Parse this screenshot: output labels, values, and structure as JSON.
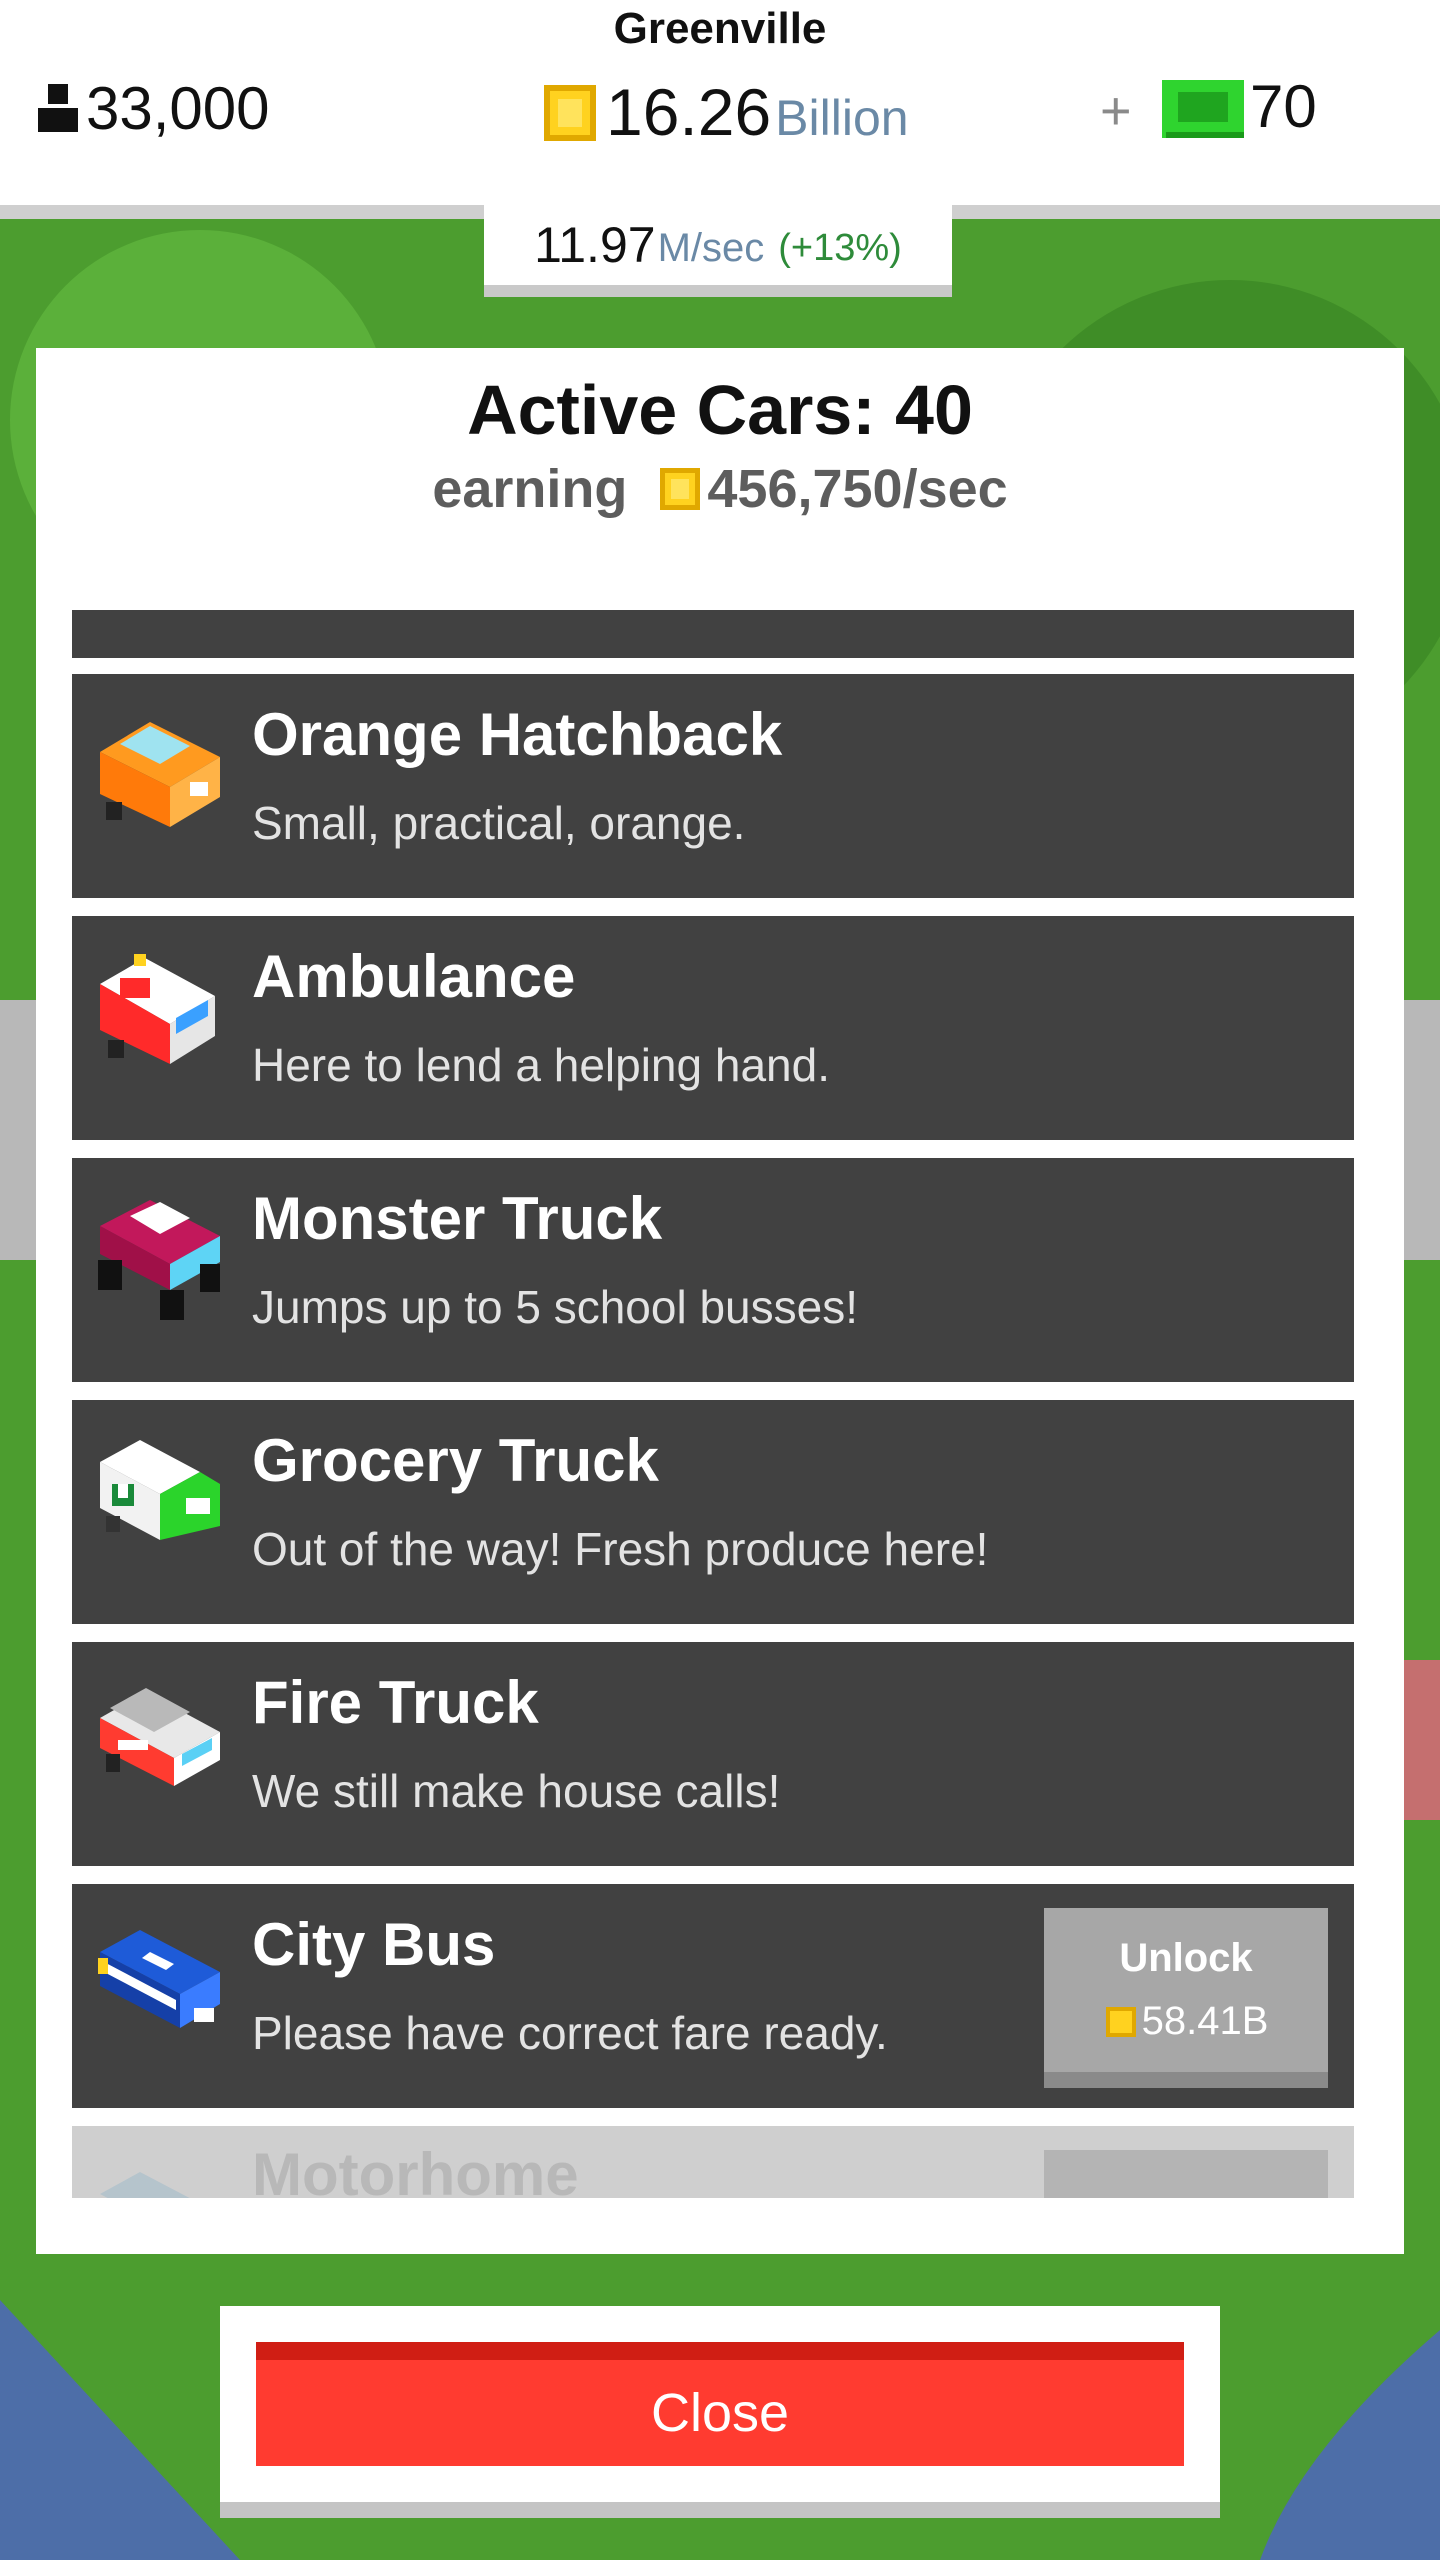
{
  "header": {
    "city": "Greenville",
    "population": "33,000",
    "money_value": "16.26",
    "money_unit": "Billion",
    "plus": "+",
    "cash_value": "70",
    "rate_value": "11.97",
    "rate_unit": "M/sec",
    "rate_bonus": "(+13%)"
  },
  "panel": {
    "title": "Active Cars: 40",
    "earning_label": "earning",
    "earning_value": "456,750/sec"
  },
  "cars": [
    {
      "name": "Orange Hatchback",
      "desc": "Small, practical, orange.",
      "icon": "orange-hatchback-icon"
    },
    {
      "name": "Ambulance",
      "desc": "Here to lend a helping hand.",
      "icon": "ambulance-icon"
    },
    {
      "name": "Monster Truck",
      "desc": "Jumps up to 5 school busses!",
      "icon": "monster-truck-icon"
    },
    {
      "name": "Grocery Truck",
      "desc": "Out of the way! Fresh produce here!",
      "icon": "grocery-truck-icon"
    },
    {
      "name": "Fire Truck",
      "desc": "We still make house calls!",
      "icon": "fire-truck-icon"
    },
    {
      "name": "City Bus",
      "desc": "Please have correct fare ready.",
      "icon": "city-bus-icon",
      "unlock_label": "Unlock",
      "unlock_cost": "58.41B"
    },
    {
      "name": "Motorhome",
      "icon": "motorhome-icon"
    }
  ],
  "close_label": "Close",
  "colors": {
    "item_bg": "#414141",
    "close": "#ff3b30",
    "coin": "#f5c518",
    "cash": "#27c927"
  }
}
